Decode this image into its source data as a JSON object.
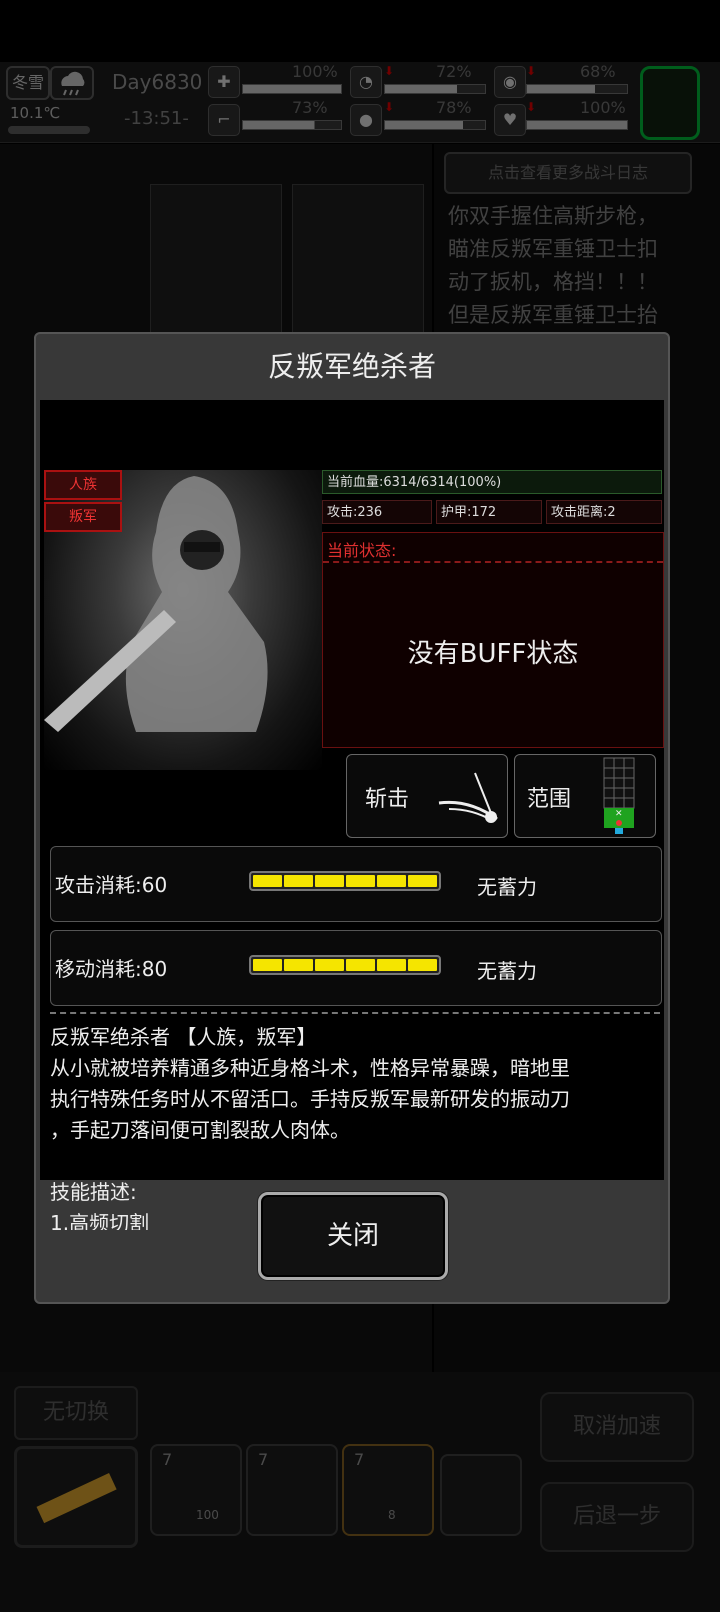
{
  "hud": {
    "season": "冬雪",
    "temperature": "10.1℃",
    "day": "Day6830",
    "time": "-13:51-",
    "stats": [
      {
        "icon": "medkit-icon",
        "value": "100%",
        "level": 1.0,
        "down": false
      },
      {
        "icon": "stomach-icon",
        "value": "72%",
        "level": 0.72,
        "down": true
      },
      {
        "icon": "bladder-icon",
        "value": "68%",
        "level": 0.68,
        "down": true
      },
      {
        "icon": "boot-icon",
        "value": "73%",
        "level": 0.73,
        "down": false
      },
      {
        "icon": "water-drop-icon",
        "value": "78%",
        "level": 0.78,
        "down": true
      },
      {
        "icon": "heart-icon",
        "value": "100%",
        "level": 1.0,
        "down": true
      }
    ]
  },
  "battle_log": {
    "button_label": "点击查看更多战斗日志",
    "lines": [
      "你双手握住高斯步枪，",
      "瞄准反叛军重锤卫士扣",
      "动了扳机，格挡！！！",
      "但是反叛军重锤卫士抬"
    ]
  },
  "modal": {
    "title": "反叛军绝杀者",
    "tags": [
      "人族",
      "叛军"
    ],
    "hp": "当前血量:6314/6314(100%)",
    "attack": "攻击:236",
    "armor": "护甲:172",
    "range": "攻击距离:2",
    "status_label": "当前状态:",
    "status_text": "没有BUFF状态",
    "action_slash": "斩击",
    "action_range": "范围",
    "attack_cost": "攻击消耗:60",
    "attack_cost_state": "无蓄力",
    "move_cost": "移动消耗:80",
    "move_cost_state": "无蓄力",
    "description": [
      "反叛军绝杀者 【人族，叛军】",
      "从小就被培养精通多种近身格斗术，性格异常暴躁，暗地里",
      "执行特殊任务时从不留活口。手持反叛军最新研发的振动刀",
      "，手起刀落间便可割裂敌人肉体。",
      "",
      "技能描述:",
      "1.高频切割"
    ],
    "close_label": "关闭"
  },
  "bottom": {
    "switch_label": "无切换",
    "cancel_speed_label": "取消加速",
    "step_back_label": "后退一步",
    "slots": [
      {
        "level": "7",
        "ammo": "100"
      },
      {
        "level": "7",
        "ammo": ""
      },
      {
        "level": "7",
        "ammo": "8"
      }
    ]
  },
  "colors": {
    "accent_red": "#e03030",
    "energy_yellow": "#f5e500",
    "hp_green": "#1f8f1f"
  }
}
